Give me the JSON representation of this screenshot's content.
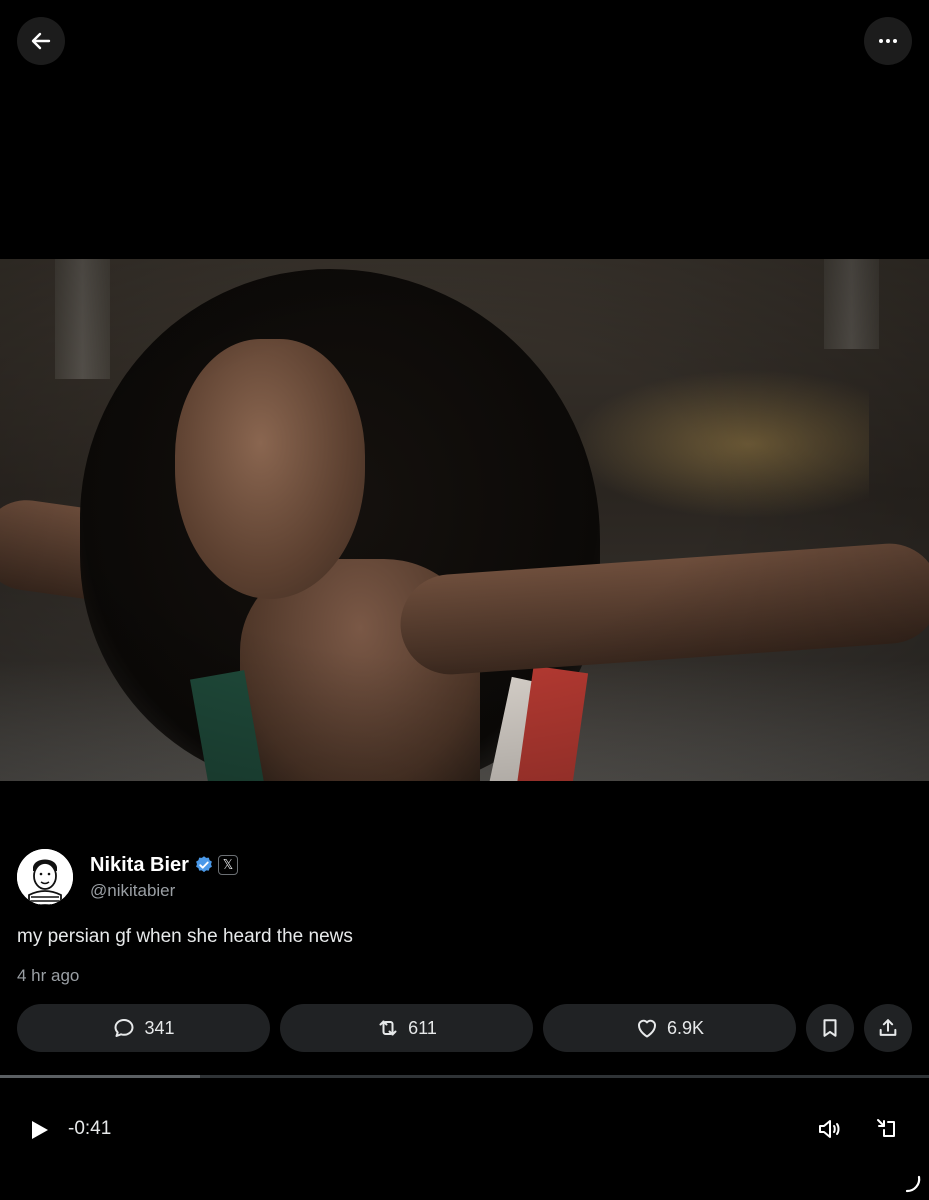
{
  "top_bar": {
    "back_icon": "arrow-left-icon",
    "more_icon": "more-horizontal-icon"
  },
  "media": {
    "type": "video",
    "description_icon": "video-frame"
  },
  "tweet": {
    "author_name": "Nikita Bier",
    "handle": "@nikitabier",
    "verified": true,
    "affiliate_badge": "𝕏",
    "text": "my persian gf when she heard the news",
    "timestamp": "4 hr ago"
  },
  "actions": {
    "reply_count": "341",
    "retweet_count": "611",
    "like_count": "6.9K",
    "bookmark_icon": "bookmark-icon",
    "share_icon": "share-icon"
  },
  "player": {
    "time_remaining": "-0:41",
    "progress": 0.215,
    "play_icon": "play-icon",
    "volume_icon": "volume-icon",
    "exit_icon": "exit-fullscreen-icon"
  },
  "colors": {
    "background": "#000000",
    "pill": "#202224",
    "verified_blue": "#1d9bf0",
    "muted_text": "#9a9fa4"
  }
}
